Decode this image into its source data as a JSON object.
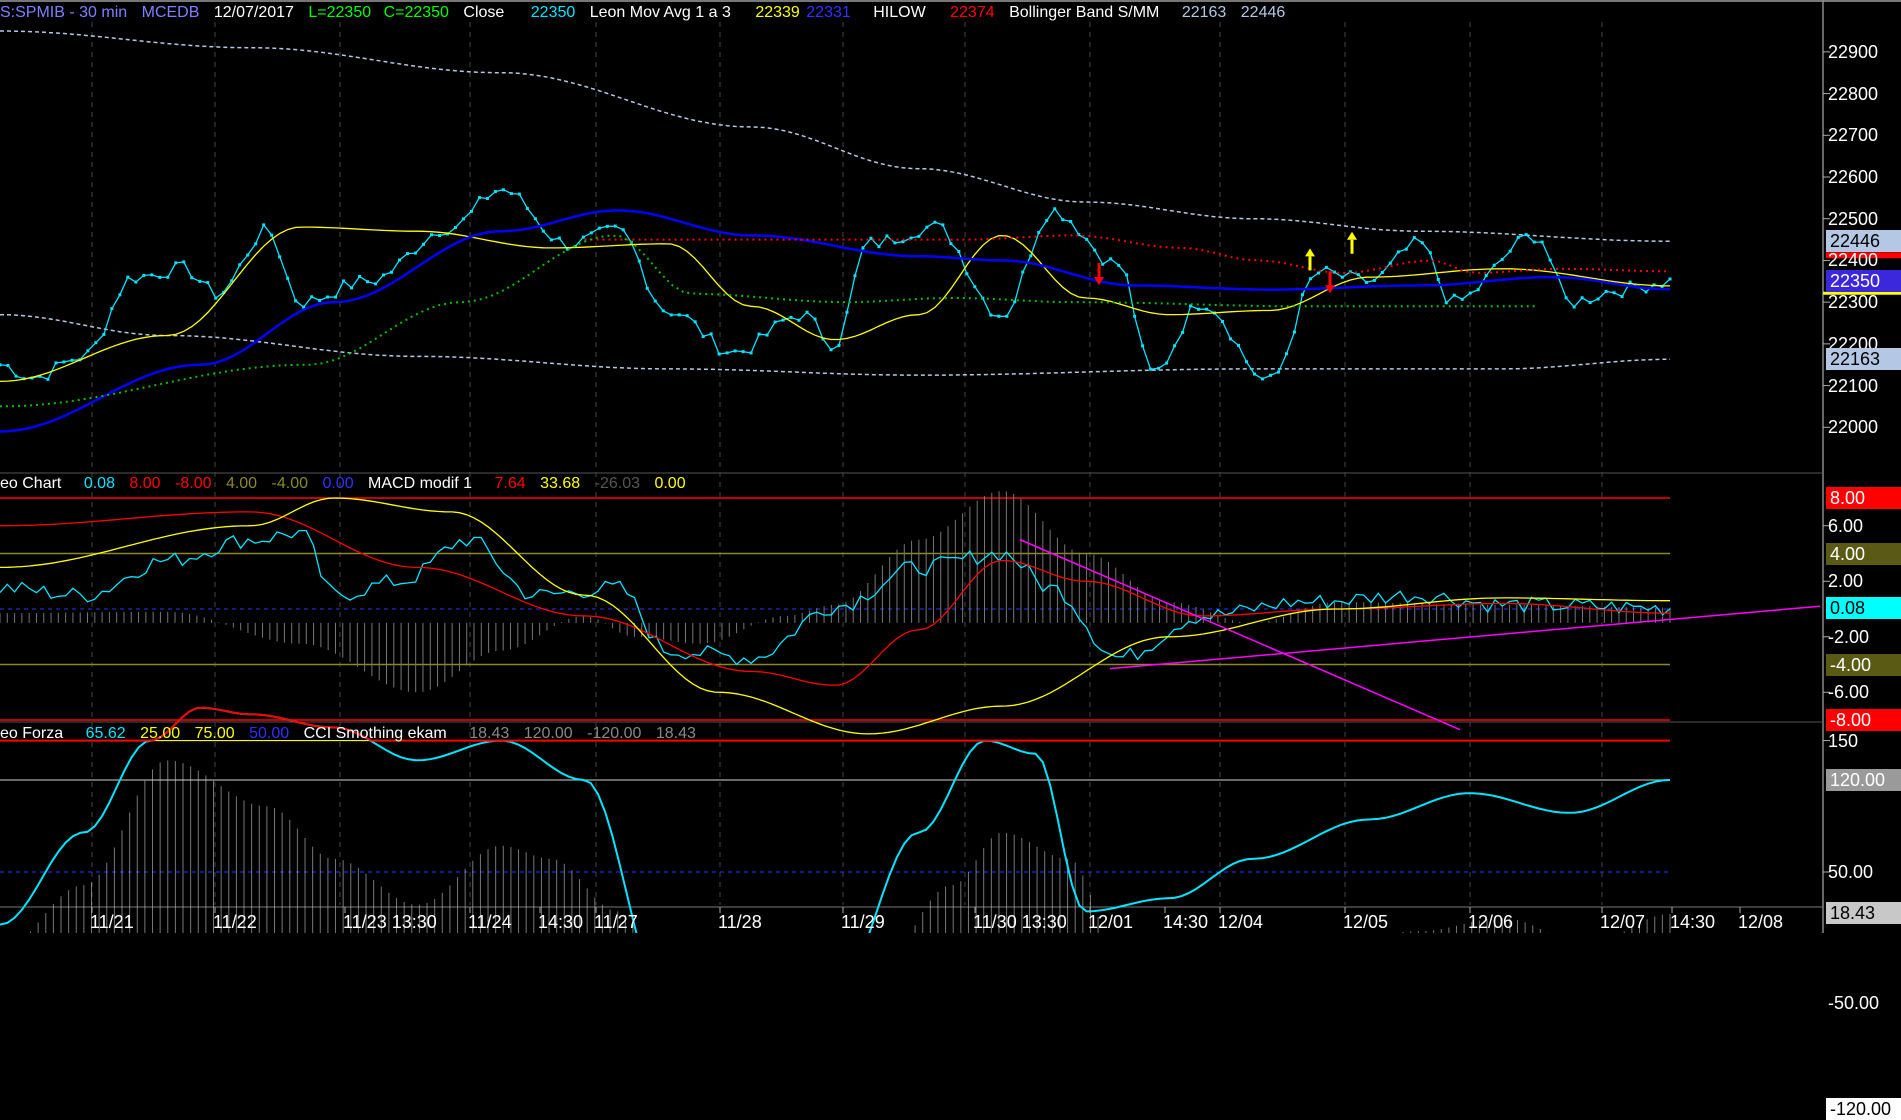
{
  "header_price": {
    "symbol": "S:SPMIB - 30 min",
    "source": "MCEDB",
    "date": "12/07/2017",
    "low": "L=22350",
    "close_eq": "C=22350",
    "close_label": "Close",
    "close_val": "22350",
    "ma_name": "Leon Mov Avg 1 a 3",
    "ma_v1": "22339",
    "ma_v2": "22331",
    "hilow_name": "HILOW",
    "hilow_val": "22374",
    "bb_name": "Bollinger Band S/MM",
    "bb_lo": "22163",
    "bb_hi": "22446"
  },
  "header_macd": {
    "name": "eo Chart",
    "v1": "0.08",
    "v2": "8.00",
    "v3": "-8.00",
    "v4": "4.00",
    "v5": "-4.00",
    "v6": "0.00",
    "macd_name": "MACD modif 1",
    "m1": "7.64",
    "m2": "33.68",
    "m3": "-26.03",
    "m4": "0.00"
  },
  "header_cci": {
    "name": "eo Forza",
    "v1": "65.62",
    "v2": "25.00",
    "v3": "75.00",
    "v4": "50.00",
    "cci_name": "CCI Smothing ekam",
    "c1": "18.43",
    "c2": "120.00",
    "c3": "-120.00",
    "c4": "18.43"
  },
  "y_ticks_price": [
    "22900",
    "22800",
    "22700",
    "22600",
    "22500",
    "22400",
    "22300",
    "22200",
    "22100",
    "22000"
  ],
  "y_ticks_macd": [
    "6.00",
    "2.00",
    "-2.00",
    "-6.00"
  ],
  "y_ticks_cci": [
    "150",
    "50.00",
    "-50.00"
  ],
  "tags": [
    {
      "text": "22446",
      "bg": "#b4c8e6",
      "fg": "#000"
    },
    {
      "text": "22350",
      "bg": "#3c28dc",
      "fg": "#fff"
    },
    {
      "text": "22163",
      "bg": "#b4c8e6",
      "fg": "#000"
    },
    {
      "text": "8.00",
      "bg": "#ff0000",
      "fg": "#fff"
    },
    {
      "text": "4.00",
      "bg": "#5a5a14",
      "fg": "#fff"
    },
    {
      "text": "0.08",
      "bg": "#00ffff",
      "fg": "#000"
    },
    {
      "text": "-4.00",
      "bg": "#5a5a14",
      "fg": "#fff"
    },
    {
      "text": "-8.00",
      "bg": "#ff0000",
      "fg": "#fff"
    },
    {
      "text": "120.00",
      "bg": "#9a9a9a",
      "fg": "#fff"
    },
    {
      "text": "18.43",
      "bg": "#c8c8c8",
      "fg": "#000"
    },
    {
      "text": "-120.00",
      "bg": "#ffffff",
      "fg": "#000"
    }
  ],
  "x_ticks": [
    "11/21",
    "11/22",
    "11/23 13:30",
    "11/24",
    "14:30",
    "11/27",
    "11/28",
    "11/29",
    "11/30 13:30",
    "12/01",
    "14:30",
    "12/04",
    "12/05",
    "12/06",
    "12/07",
    "14:30",
    "12/08"
  ],
  "colors": {
    "price": "#00e5ff",
    "ma_fast": "#ffff00",
    "ma_slow": "#0000ff",
    "hilow_up": "#ff0000",
    "hilow_down": "#00c000",
    "bollinger": "#b4c8e6",
    "macd_line": "#00e5ff",
    "macd_signal": "#ff0000",
    "macd_slow": "#ffff00",
    "cci": "#00e5ff",
    "cci_over": "#ff0000",
    "cci_hist": "#c8c8c8",
    "trendline": "#ff00ff"
  },
  "chart_data": [
    {
      "type": "line",
      "title": "S:SPMIB - 30 min",
      "x": [
        "11/21",
        "11/22",
        "11/23",
        "11/24",
        "11/27",
        "11/28",
        "11/29",
        "11/30",
        "12/01",
        "12/04",
        "12/05",
        "12/06",
        "12/07"
      ],
      "ylim": [
        21900,
        22950
      ],
      "series": [
        {
          "name": "Close",
          "values": [
            22110,
            22380,
            22330,
            22560,
            22460,
            22200,
            22440,
            22510,
            22110,
            22350,
            22450,
            22310,
            22350
          ]
        },
        {
          "name": "Leon Mov Avg 1 a 3",
          "values": [
            22120,
            22490,
            22400,
            22460,
            22440,
            22260,
            22340,
            22510,
            22300,
            22290,
            22340,
            22380,
            22339
          ]
        },
        {
          "name": "Bollinger Band S/MM",
          "values": [
            22470,
            22440,
            22400,
            22370,
            22330,
            22310,
            22260,
            22240,
            22210,
            22190,
            22180,
            22170,
            22163
          ]
        }
      ]
    },
    {
      "type": "line",
      "title": "MACD modif 1",
      "x": [
        "11/21",
        "11/22",
        "11/23",
        "11/24",
        "11/27",
        "11/28",
        "11/29",
        "11/30",
        "12/01",
        "12/04",
        "12/05",
        "12/06",
        "12/07"
      ],
      "ylim": [
        -8,
        8
      ],
      "series": [
        {
          "name": "Leo Chart",
          "values": [
            2.0,
            4.5,
            2.0,
            4.0,
            1.5,
            -3.0,
            0.5,
            3.5,
            -3.0,
            0.0,
            0.8,
            1.0,
            0.08
          ]
        }
      ]
    },
    {
      "type": "line",
      "title": "CCI Smothing ekam",
      "x": [
        "11/21",
        "11/22",
        "11/23",
        "11/24",
        "11/27",
        "11/28",
        "11/29",
        "11/30",
        "12/01",
        "12/04",
        "12/05",
        "12/06",
        "12/07"
      ],
      "ylim": [
        -130,
        190
      ],
      "series": [
        {
          "name": "Leo Forza",
          "values": [
            20,
            175,
            150,
            140,
            110,
            -130,
            -50,
            140,
            20,
            60,
            100,
            110,
            120
          ]
        }
      ]
    }
  ]
}
